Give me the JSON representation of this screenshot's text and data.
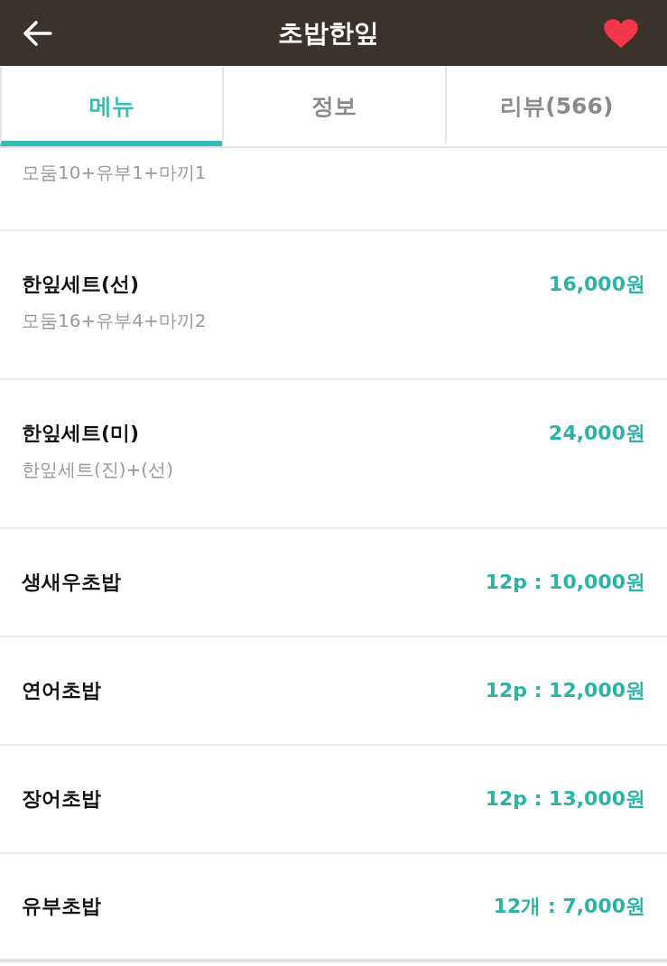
{
  "header": {
    "title": "초밥한잎",
    "favorited": true
  },
  "tabs": [
    {
      "label": "메뉴",
      "selected": true
    },
    {
      "label": "정보",
      "selected": false
    },
    {
      "label": "리뷰(566)",
      "selected": false
    }
  ],
  "menu_items": [
    {
      "description": "모둠10+유부1+마끼1"
    },
    {
      "name": "한잎세트(선)",
      "price": "16,000원",
      "description": "모둠16+유부4+마끼2"
    },
    {
      "name": "한잎세트(미)",
      "price": "24,000원",
      "description": "한잎세트(진)+(선)"
    },
    {
      "name": "생새우초밥",
      "price": "12p : 10,000원"
    },
    {
      "name": "연어초밥",
      "price": "12p : 12,000원"
    },
    {
      "name": "장어초밥",
      "price": "12p : 13,000원"
    },
    {
      "name": "유부초밥",
      "price": "12개 : 7,000원"
    }
  ]
}
